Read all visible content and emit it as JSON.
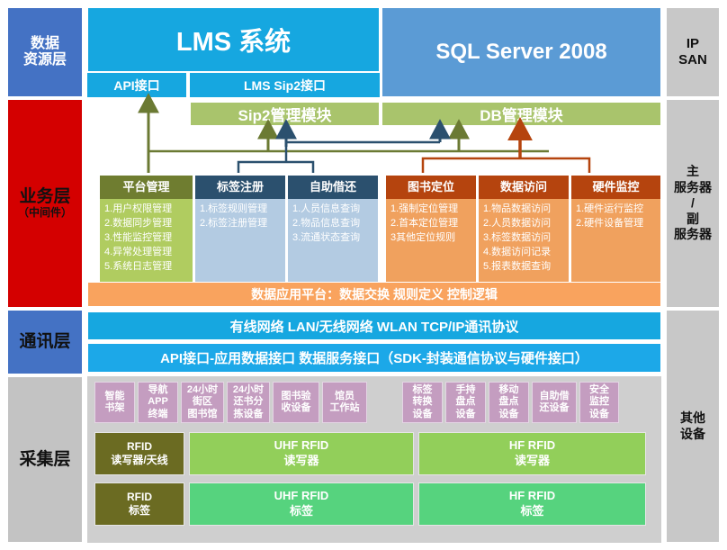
{
  "layers": {
    "left": [
      {
        "label": "数据\n资源层",
        "sub": ""
      },
      {
        "label": "业务层",
        "sub": "（中间件）"
      },
      {
        "label": "通讯层",
        "sub": ""
      },
      {
        "label": "采集层",
        "sub": ""
      }
    ],
    "right": [
      {
        "label": "IP\nSAN"
      },
      {
        "label": "主\n服务器\n/\n副\n服务器"
      },
      {
        "label": "其他\n设备"
      }
    ]
  },
  "data_layer": {
    "lms_title": "LMS 系统",
    "sql_title": "SQL Server 2008",
    "api_interface": "API接口",
    "lms_sip2_interface": "LMS Sip2接口"
  },
  "modules": {
    "sip2": "Sip2管理模块",
    "db": "DB管理模块"
  },
  "business_boxes": [
    {
      "title": "平台管理",
      "theme": "green",
      "items": [
        "1.用户权限管理",
        "2.数据同步管理",
        "3.性能监控管理",
        "4.异常处理管理",
        "5.系统日志管理"
      ]
    },
    {
      "title": "标签注册",
      "theme": "blue",
      "items": [
        "1.标签规则管理",
        "2.标签注册管理"
      ]
    },
    {
      "title": "自助借还",
      "theme": "blue",
      "items": [
        "1.人员信息查询",
        "2.物品信息查询",
        "3.流通状态查询"
      ]
    },
    {
      "title": "图书定位",
      "theme": "orange",
      "items": [
        "1.强制定位管理",
        "2.首本定位管理",
        "3其他定位规则"
      ]
    },
    {
      "title": "数据访问",
      "theme": "orange",
      "items": [
        "1.物品数据访问",
        "2.人员数据访问",
        "3.标签数据访问",
        "4.数据访问记录",
        "5.报表数据查询"
      ]
    },
    {
      "title": "硬件监控",
      "theme": "orange",
      "items": [
        "1.硬件运行监控",
        "2.硬件设备管理"
      ]
    }
  ],
  "data_app_platform": "数据应用平台：数据交换 规则定义 控制逻辑",
  "communication": {
    "line1": "有线网络 LAN/无线网络 WLAN    TCP/IP通讯协议",
    "line2": "API接口-应用数据接口 数据服务接口（SDK-封装通信协议与硬件接口）"
  },
  "devices": [
    "智能\n书架",
    "导航\nAPP\n终端",
    "24小时\n街区\n图书馆",
    "24小时\n还书分\n拣设备",
    "图书验\n收设备",
    "馆员\n工作站",
    "标签\n转换\n设备",
    "手持\n盘点\n设备",
    "移动\n盘点\n设备",
    "自助借\n还设备",
    "安全\n监控\n设备"
  ],
  "rfid_readers": [
    {
      "label": "RFID\n读写器/天线",
      "theme": "dark"
    },
    {
      "label": "UHF RFID\n读写器",
      "theme": "light"
    },
    {
      "label": "HF RFID\n读写器",
      "theme": "light"
    }
  ],
  "rfid_tags": [
    {
      "label": "RFID\n标签",
      "theme": "dark"
    },
    {
      "label": "UHF RFID\n标签",
      "theme": "mid"
    },
    {
      "label": "HF RFID\n标签",
      "theme": "mid"
    }
  ],
  "colors": {
    "rail_blue": "#4472c4",
    "rail_red": "#d40000",
    "rail_grey": "#c3c3c3",
    "rail_right": "#c8c8c8",
    "lms_blue": "#16a7e0",
    "sql_blue": "#5b9bd5",
    "module_green": "#a9c46c",
    "green_head": "#6f7d30",
    "green_body": "#b0cc60",
    "blue_head": "#2b506e",
    "blue_body": "#b3cbe2",
    "orange_head": "#b5440e",
    "orange_body": "#f0a15e",
    "dap_orange": "#f9a35e",
    "device_purple": "#c49dc0",
    "rfid_dark": "#6b6b22",
    "rfid_light": "#92cf5a",
    "rfid_mid": "#56d37e",
    "arrow_olive": "#6b7a33",
    "arrow_steel": "#2b506e",
    "arrow_rust": "#b5440e"
  }
}
